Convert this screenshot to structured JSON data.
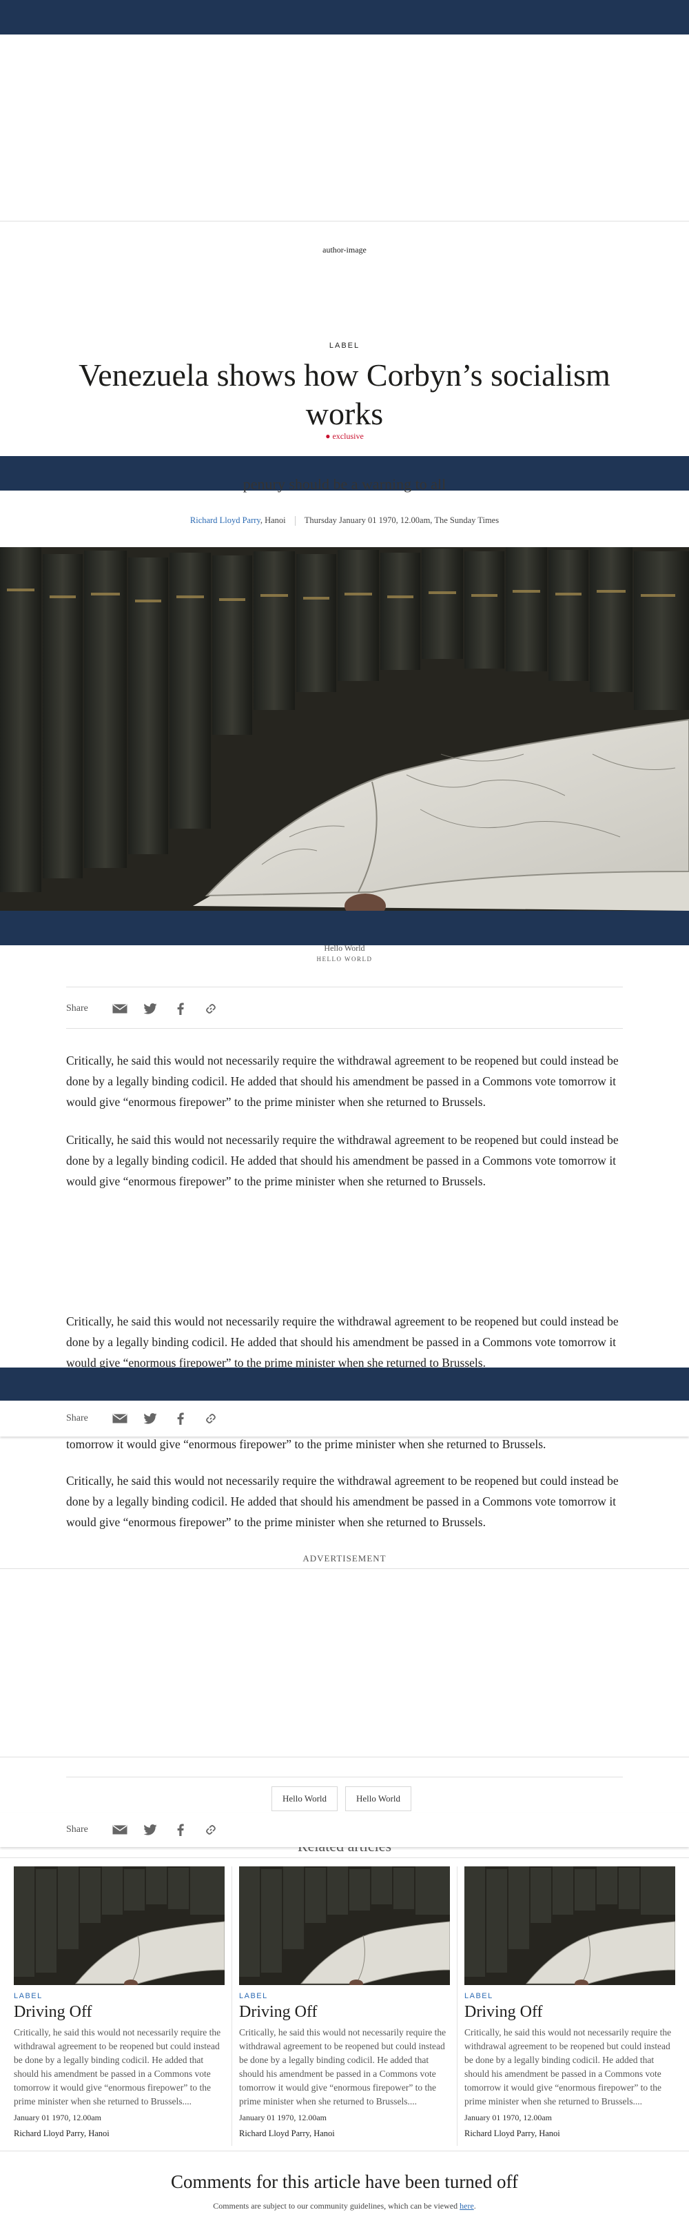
{
  "header": {
    "author_image_alt": "author-image"
  },
  "article": {
    "label": "LABEL",
    "headline": "Venezuela shows how Corbyn’s socialism works",
    "tag": "exclusive",
    "standfirst_fragment": "penury should be a warning to all",
    "author": "Richard Lloyd Parry",
    "location": ", Hanoi",
    "dateline": "Thursday January 01 1970, 12.00am, The Sunday Times",
    "caption": "Hello World",
    "credit": "HELLO WORLD",
    "paragraph": "Critically, he said this would not necessarily require the withdrawal agreement to be reopened but could instead be done by a legally binding codicil. He added that should his amendment be passed in a Commons vote tomorrow it would give “enormous firepower” to the prime minister when she returned to Brussels.",
    "paragraph_tail_1": "tomorrow it would give “enormous firepower” to the prime minister when she returned to Brussels.",
    "paragraph_tail_2": "tomorrow it would give “enormous firepower” to the prime minister when she returned to Brussels."
  },
  "share": {
    "label": "Share"
  },
  "advertisement": {
    "label": "ADVERTISEMENT"
  },
  "topics": [
    "Hello World",
    "Hello World"
  ],
  "related": {
    "heading": "Related articles",
    "cards": [
      {
        "label": "LABEL",
        "title": "Driving Off",
        "summary": "Critically, he said this would not necessarily require the withdrawal agreement to be reopened but could instead be done by a legally binding codicil. He added that should his amendment be passed in a Commons vote tomorrow it would give “enormous firepower” to the prime minister when she returned to Brussels....",
        "date": "January 01 1970, 12.00am",
        "author": "Richard Lloyd Parry, Hanoi"
      },
      {
        "label": "LABEL",
        "title": "Driving Off",
        "summary": "Critically, he said this would not necessarily require the withdrawal agreement to be reopened but could instead be done by a legally binding codicil. He added that should his amendment be passed in a Commons vote tomorrow it would give “enormous firepower” to the prime minister when she returned to Brussels....",
        "date": "January 01 1970, 12.00am",
        "author": "Richard Lloyd Parry, Hanoi"
      },
      {
        "label": "LABEL",
        "title": "Driving Off",
        "summary": "Critically, he said this would not necessarily require the withdrawal agreement to be reopened but could instead be done by a legally binding codicil. He added that should his amendment be passed in a Commons vote tomorrow it would give “enormous firepower” to the prime minister when she returned to Brussels....",
        "date": "January 01 1970, 12.00am",
        "author": "Richard Lloyd Parry, Hanoi"
      }
    ]
  },
  "comments": {
    "heading": "Comments for this article have been turned off",
    "note": "Comments are subject to our community guidelines, which can be viewed ",
    "link": "here",
    "note_end": "."
  },
  "colors": {
    "navy": "#1f3555",
    "link_blue": "#2b6ab3",
    "exclusive_red": "#c8102e"
  },
  "icons": [
    "email-icon",
    "twitter-icon",
    "facebook-icon",
    "link-icon"
  ]
}
